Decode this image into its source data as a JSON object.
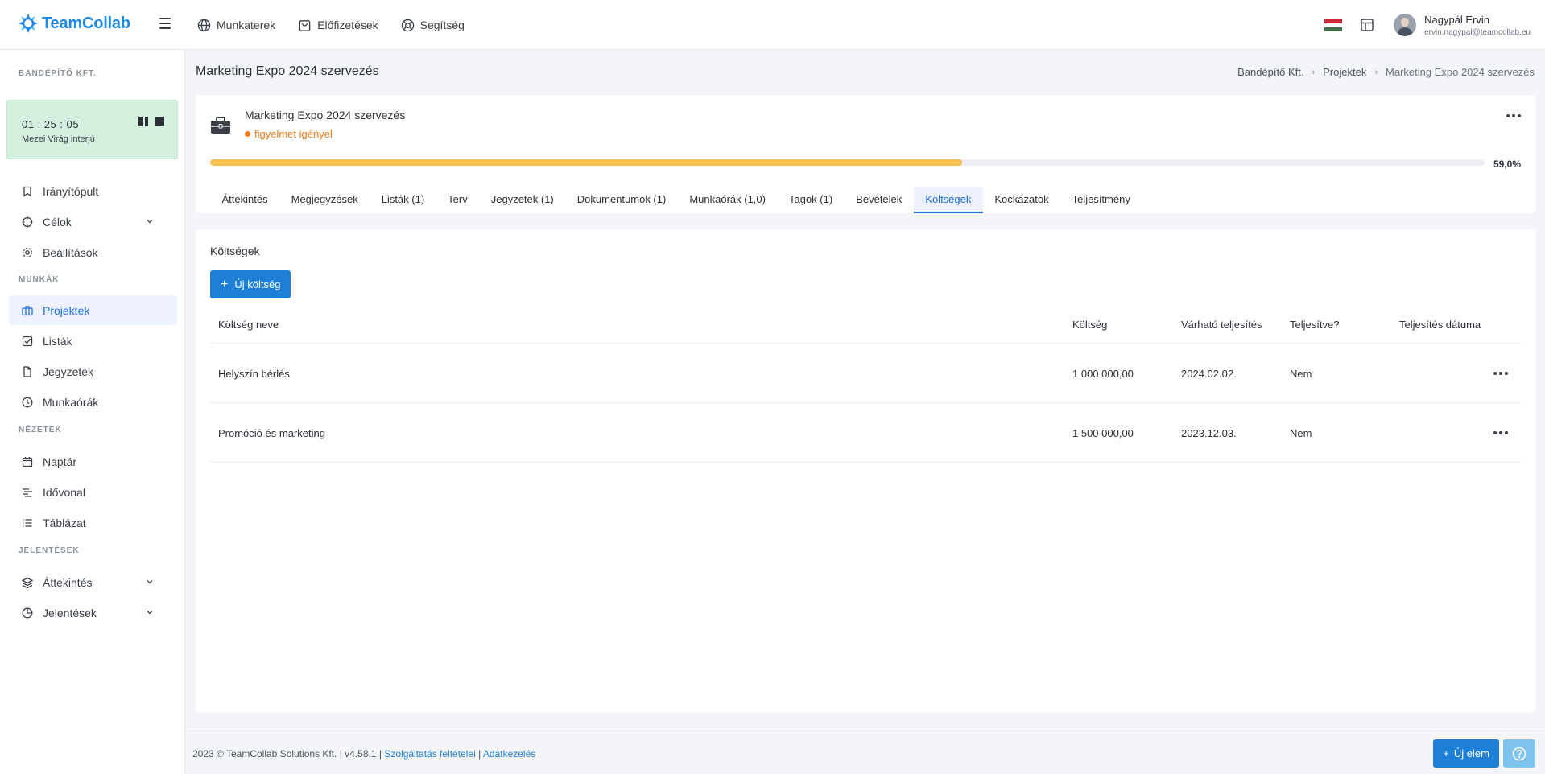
{
  "brand": {
    "name": "TeamCollab",
    "color": "#1e88e5"
  },
  "topnav": [
    {
      "label": "Munkaterek",
      "icon": "globe-icon"
    },
    {
      "label": "Előfizetések",
      "icon": "shopping-bag-icon"
    },
    {
      "label": "Segítség",
      "icon": "lifebuoy-icon"
    }
  ],
  "user": {
    "name": "Nagypál Ervin",
    "email": "ervin.nagypal@teamcollab.eu"
  },
  "sidebar": {
    "company": "BANDÉPÍTŐ KFT.",
    "timer": {
      "time": "01 : 25 : 05",
      "label": "Mezei Virág interjú"
    },
    "items": [
      {
        "label": "Irányítópult",
        "icon": "bookmark-icon"
      },
      {
        "label": "Célok",
        "icon": "target-icon"
      },
      {
        "label": "Beállítások",
        "icon": "gear-icon"
      },
      {
        "label": "Projektek",
        "icon": "briefcase-icon"
      },
      {
        "label": "Listák",
        "icon": "checkbox-icon"
      },
      {
        "label": "Jegyzetek",
        "icon": "file-icon"
      },
      {
        "label": "Munkaórák",
        "icon": "clock-icon"
      },
      {
        "label": "Naptár",
        "icon": "calendar-icon"
      },
      {
        "label": "Idővonal",
        "icon": "timeline-icon"
      },
      {
        "label": "Táblázat",
        "icon": "list-icon"
      },
      {
        "label": "Áttekintés",
        "icon": "layers-icon"
      },
      {
        "label": "Jelentések",
        "icon": "pie-chart-icon"
      }
    ],
    "sections": [
      "MUNKÁK",
      "NÉZETEK",
      "JELENTÉSEK"
    ]
  },
  "page": {
    "title": "Marketing Expo 2024 szervezés"
  },
  "breadcrumb": [
    "Bandépítő Kft.",
    "Projektek",
    "Marketing Expo 2024 szervezés"
  ],
  "project": {
    "name": "Marketing Expo 2024 szervezés",
    "status": "figyelmet igényel",
    "status_color": "#f07c1b",
    "progress": 0.59,
    "progress_label": "59,0%",
    "tabs": [
      "Áttekintés",
      "Megjegyzések",
      "Listák (1)",
      "Terv",
      "Jegyzetek (1)",
      "Dokumentumok (1)",
      "Munkaórák (1,0)",
      "Tagok (1)",
      "Bevételek",
      "Költségek",
      "Kockázatok",
      "Teljesítmény"
    ],
    "active_tab": "Költségek"
  },
  "costs": {
    "title": "Költségek",
    "new_button": "Új költség",
    "columns": [
      "Költség neve",
      "Költség",
      "Várható teljesítés",
      "Teljesítve?",
      "Teljesítés dátuma"
    ],
    "rows": [
      {
        "name": "Helyszín bérlés",
        "cost": "1 000 000,00",
        "due": "2024.02.02.",
        "done": "Nem",
        "date": ""
      },
      {
        "name": "Promóció és marketing",
        "cost": "1 500 000,00",
        "due": "2023.12.03.",
        "done": "Nem",
        "date": ""
      }
    ]
  },
  "footer": {
    "copyright": "2023 © TeamCollab Solutions Kft. | v4.58.1 |",
    "terms": "Szolgáltatás feltételei",
    "sep": "|",
    "privacy": "Adatkezelés",
    "new_item": "Új elem"
  }
}
